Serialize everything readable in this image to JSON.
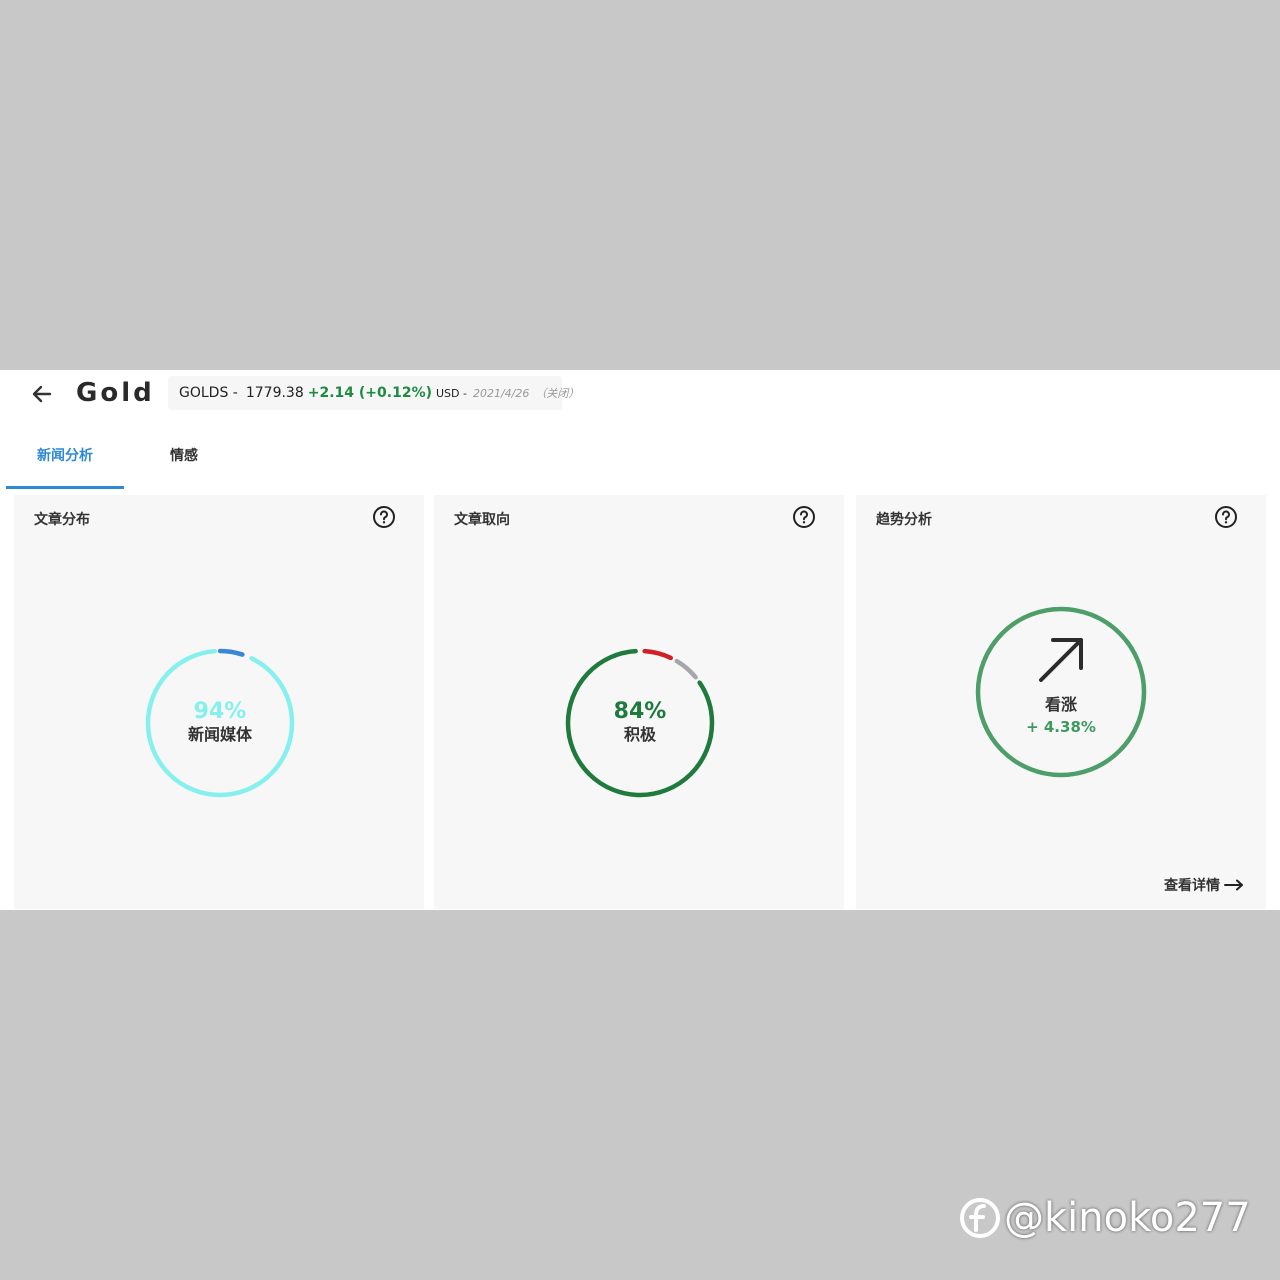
{
  "header": {
    "title": "Gold",
    "ticker": {
      "symbol": "GOLDS -",
      "price": "1779.38",
      "change": "+2.14 (+0.12%)",
      "currency": "USD -",
      "date": "2021/4/26",
      "status": "（关闭）"
    }
  },
  "tabs": [
    {
      "label": "新闻分析",
      "active": true
    },
    {
      "label": "情感",
      "active": false
    }
  ],
  "cards": {
    "distribution": {
      "title": "文章分布",
      "percent": "94%",
      "percent_value": 94,
      "label": "新闻媒体",
      "colors": {
        "primary": "#86f0ee",
        "secondary": "#3a86d6"
      }
    },
    "orientation": {
      "title": "文章取向",
      "percent": "84%",
      "percent_value": 84,
      "label": "积极",
      "colors": {
        "positive": "#1f7a3e",
        "negative": "#d0202a",
        "neutral": "#a6a6ab"
      }
    },
    "trend": {
      "title": "趋势分析",
      "label": "看涨",
      "change": "+ 4.38%",
      "detail_link": "查看详情",
      "colors": {
        "ring": "#4e9e6a",
        "arrow": "#2b2b2b"
      }
    }
  },
  "watermark": {
    "text": "@kinoko277"
  }
}
